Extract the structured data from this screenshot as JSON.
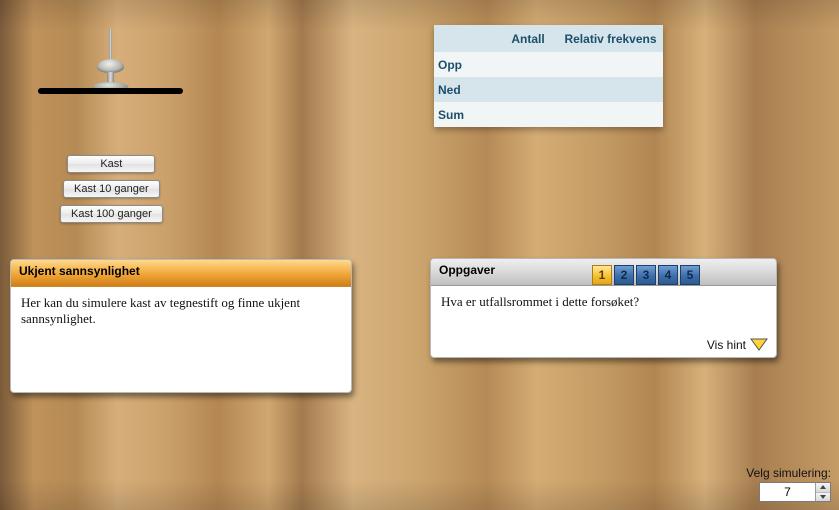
{
  "buttons": {
    "kast": "Kast",
    "kast10": "Kast 10 ganger",
    "kast100": "Kast 100 ganger"
  },
  "table": {
    "headers": {
      "c0": "",
      "c1": "Antall",
      "c2": "Relativ frekvens"
    },
    "rows": [
      {
        "label": "Opp",
        "antall": "",
        "relativ": ""
      },
      {
        "label": "Ned",
        "antall": "",
        "relativ": ""
      },
      {
        "label": "Sum",
        "antall": "",
        "relativ": ""
      }
    ]
  },
  "info": {
    "title": "Ukjent sannsynlighet",
    "body": "Her kan du simulere kast av tegnestift og finne ukjent sannsynlighet."
  },
  "tasks": {
    "title": "Oppgaver",
    "numbers": [
      "1",
      "2",
      "3",
      "4",
      "5"
    ],
    "active_index": 0,
    "question": "Hva er utfallsrommet i dette forsøket?",
    "hint_label": "Vis hint"
  },
  "simselect": {
    "label": "Velg simulering:",
    "value": "7"
  }
}
